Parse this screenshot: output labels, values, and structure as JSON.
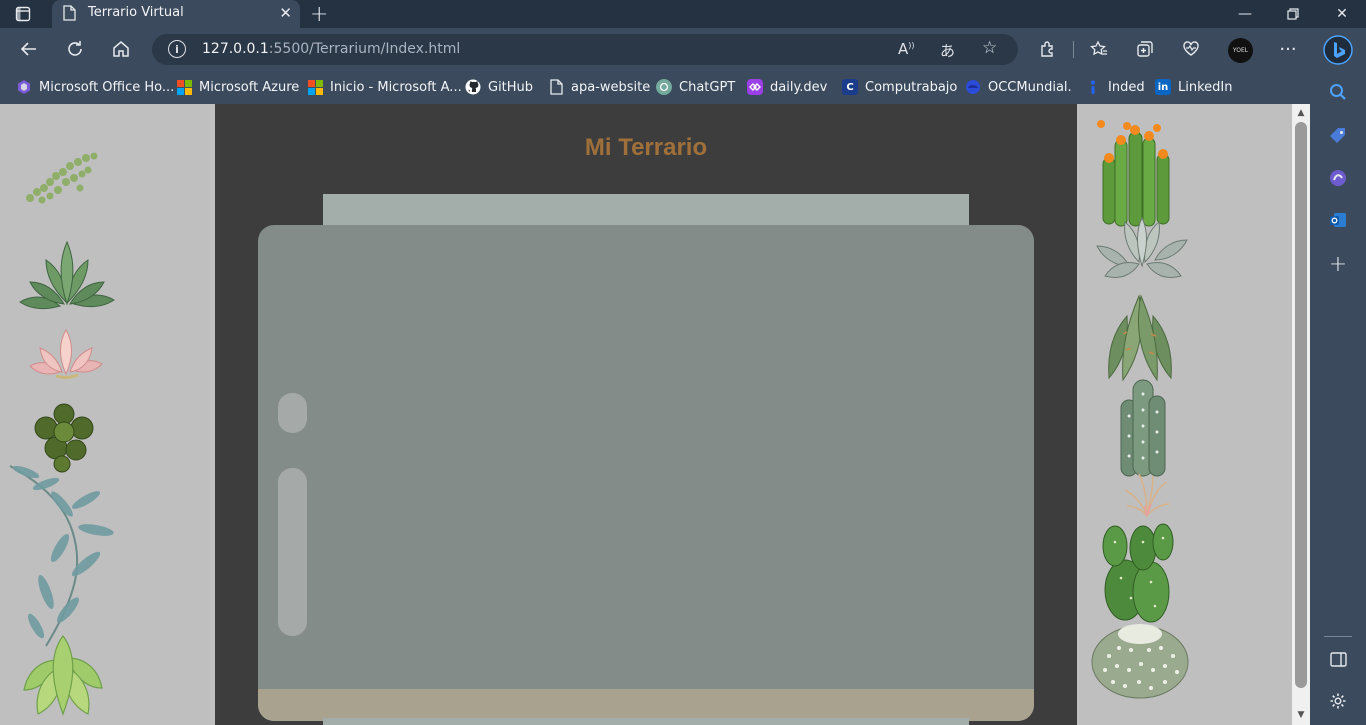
{
  "browser": {
    "tab_title": "Terrario Virtual",
    "url_host": "127.0.0.1",
    "url_rest": ":5500/Terrarium/Index.html",
    "avatar_label": "YOEL",
    "bookmarks": [
      {
        "label": "Microsoft Office Ho...",
        "icon": "office-icon",
        "color": "#7b5cd6"
      },
      {
        "label": "Microsoft Azure",
        "icon": "microsoft-icon",
        "color": "#f25022"
      },
      {
        "label": "Inicio - Microsoft A...",
        "icon": "microsoft-icon",
        "color": "#f25022"
      },
      {
        "label": "GitHub",
        "icon": "github-icon",
        "color": "#ffffff"
      },
      {
        "label": "apa-website",
        "icon": "page-icon",
        "color": "#e6e9ee"
      },
      {
        "label": "ChatGPT",
        "icon": "chatgpt-icon",
        "color": "#74aa9c"
      },
      {
        "label": "daily.dev",
        "icon": "dailydev-icon",
        "color": "#9b3fe6"
      },
      {
        "label": "Computrabajo",
        "icon": "computrabajo-icon",
        "color": "#1b3b8b"
      },
      {
        "label": "OCCMundial.",
        "icon": "occ-icon",
        "color": "#2b4cd8"
      },
      {
        "label": "Inded",
        "icon": "indeed-icon",
        "color": "#2164f3"
      },
      {
        "label": "LinkedIn",
        "icon": "linkedin-icon",
        "color": "#0a66c2"
      }
    ]
  },
  "page": {
    "title": "Mi Terrario",
    "colors": {
      "side_panel": "#bfbfbf",
      "background": "#3d3d3d",
      "title": "#a0703a",
      "jar_body": "#848c8a",
      "jar_top": "#a3aeaa",
      "dirt": "#a9a28f"
    }
  }
}
